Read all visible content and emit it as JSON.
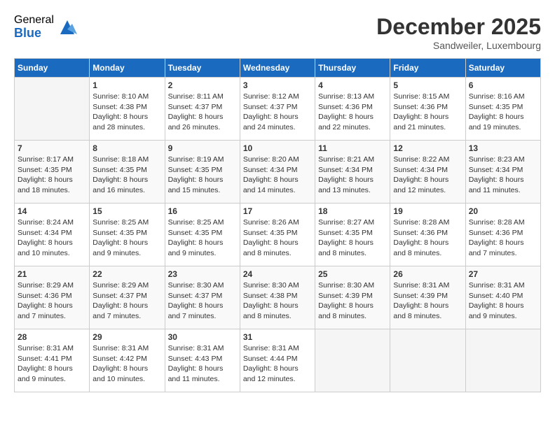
{
  "logo": {
    "general": "General",
    "blue": "Blue"
  },
  "title": "December 2025",
  "location": "Sandweiler, Luxembourg",
  "days_of_week": [
    "Sunday",
    "Monday",
    "Tuesday",
    "Wednesday",
    "Thursday",
    "Friday",
    "Saturday"
  ],
  "weeks": [
    [
      {
        "day": "",
        "sunrise": "",
        "sunset": "",
        "daylight": ""
      },
      {
        "day": "1",
        "sunrise": "Sunrise: 8:10 AM",
        "sunset": "Sunset: 4:38 PM",
        "daylight": "Daylight: 8 hours and 28 minutes."
      },
      {
        "day": "2",
        "sunrise": "Sunrise: 8:11 AM",
        "sunset": "Sunset: 4:37 PM",
        "daylight": "Daylight: 8 hours and 26 minutes."
      },
      {
        "day": "3",
        "sunrise": "Sunrise: 8:12 AM",
        "sunset": "Sunset: 4:37 PM",
        "daylight": "Daylight: 8 hours and 24 minutes."
      },
      {
        "day": "4",
        "sunrise": "Sunrise: 8:13 AM",
        "sunset": "Sunset: 4:36 PM",
        "daylight": "Daylight: 8 hours and 22 minutes."
      },
      {
        "day": "5",
        "sunrise": "Sunrise: 8:15 AM",
        "sunset": "Sunset: 4:36 PM",
        "daylight": "Daylight: 8 hours and 21 minutes."
      },
      {
        "day": "6",
        "sunrise": "Sunrise: 8:16 AM",
        "sunset": "Sunset: 4:35 PM",
        "daylight": "Daylight: 8 hours and 19 minutes."
      }
    ],
    [
      {
        "day": "7",
        "sunrise": "Sunrise: 8:17 AM",
        "sunset": "Sunset: 4:35 PM",
        "daylight": "Daylight: 8 hours and 18 minutes."
      },
      {
        "day": "8",
        "sunrise": "Sunrise: 8:18 AM",
        "sunset": "Sunset: 4:35 PM",
        "daylight": "Daylight: 8 hours and 16 minutes."
      },
      {
        "day": "9",
        "sunrise": "Sunrise: 8:19 AM",
        "sunset": "Sunset: 4:35 PM",
        "daylight": "Daylight: 8 hours and 15 minutes."
      },
      {
        "day": "10",
        "sunrise": "Sunrise: 8:20 AM",
        "sunset": "Sunset: 4:34 PM",
        "daylight": "Daylight: 8 hours and 14 minutes."
      },
      {
        "day": "11",
        "sunrise": "Sunrise: 8:21 AM",
        "sunset": "Sunset: 4:34 PM",
        "daylight": "Daylight: 8 hours and 13 minutes."
      },
      {
        "day": "12",
        "sunrise": "Sunrise: 8:22 AM",
        "sunset": "Sunset: 4:34 PM",
        "daylight": "Daylight: 8 hours and 12 minutes."
      },
      {
        "day": "13",
        "sunrise": "Sunrise: 8:23 AM",
        "sunset": "Sunset: 4:34 PM",
        "daylight": "Daylight: 8 hours and 11 minutes."
      }
    ],
    [
      {
        "day": "14",
        "sunrise": "Sunrise: 8:24 AM",
        "sunset": "Sunset: 4:34 PM",
        "daylight": "Daylight: 8 hours and 10 minutes."
      },
      {
        "day": "15",
        "sunrise": "Sunrise: 8:25 AM",
        "sunset": "Sunset: 4:35 PM",
        "daylight": "Daylight: 8 hours and 9 minutes."
      },
      {
        "day": "16",
        "sunrise": "Sunrise: 8:25 AM",
        "sunset": "Sunset: 4:35 PM",
        "daylight": "Daylight: 8 hours and 9 minutes."
      },
      {
        "day": "17",
        "sunrise": "Sunrise: 8:26 AM",
        "sunset": "Sunset: 4:35 PM",
        "daylight": "Daylight: 8 hours and 8 minutes."
      },
      {
        "day": "18",
        "sunrise": "Sunrise: 8:27 AM",
        "sunset": "Sunset: 4:35 PM",
        "daylight": "Daylight: 8 hours and 8 minutes."
      },
      {
        "day": "19",
        "sunrise": "Sunrise: 8:28 AM",
        "sunset": "Sunset: 4:36 PM",
        "daylight": "Daylight: 8 hours and 8 minutes."
      },
      {
        "day": "20",
        "sunrise": "Sunrise: 8:28 AM",
        "sunset": "Sunset: 4:36 PM",
        "daylight": "Daylight: 8 hours and 7 minutes."
      }
    ],
    [
      {
        "day": "21",
        "sunrise": "Sunrise: 8:29 AM",
        "sunset": "Sunset: 4:36 PM",
        "daylight": "Daylight: 8 hours and 7 minutes."
      },
      {
        "day": "22",
        "sunrise": "Sunrise: 8:29 AM",
        "sunset": "Sunset: 4:37 PM",
        "daylight": "Daylight: 8 hours and 7 minutes."
      },
      {
        "day": "23",
        "sunrise": "Sunrise: 8:30 AM",
        "sunset": "Sunset: 4:37 PM",
        "daylight": "Daylight: 8 hours and 7 minutes."
      },
      {
        "day": "24",
        "sunrise": "Sunrise: 8:30 AM",
        "sunset": "Sunset: 4:38 PM",
        "daylight": "Daylight: 8 hours and 8 minutes."
      },
      {
        "day": "25",
        "sunrise": "Sunrise: 8:30 AM",
        "sunset": "Sunset: 4:39 PM",
        "daylight": "Daylight: 8 hours and 8 minutes."
      },
      {
        "day": "26",
        "sunrise": "Sunrise: 8:31 AM",
        "sunset": "Sunset: 4:39 PM",
        "daylight": "Daylight: 8 hours and 8 minutes."
      },
      {
        "day": "27",
        "sunrise": "Sunrise: 8:31 AM",
        "sunset": "Sunset: 4:40 PM",
        "daylight": "Daylight: 8 hours and 9 minutes."
      }
    ],
    [
      {
        "day": "28",
        "sunrise": "Sunrise: 8:31 AM",
        "sunset": "Sunset: 4:41 PM",
        "daylight": "Daylight: 8 hours and 9 minutes."
      },
      {
        "day": "29",
        "sunrise": "Sunrise: 8:31 AM",
        "sunset": "Sunset: 4:42 PM",
        "daylight": "Daylight: 8 hours and 10 minutes."
      },
      {
        "day": "30",
        "sunrise": "Sunrise: 8:31 AM",
        "sunset": "Sunset: 4:43 PM",
        "daylight": "Daylight: 8 hours and 11 minutes."
      },
      {
        "day": "31",
        "sunrise": "Sunrise: 8:31 AM",
        "sunset": "Sunset: 4:44 PM",
        "daylight": "Daylight: 8 hours and 12 minutes."
      },
      {
        "day": "",
        "sunrise": "",
        "sunset": "",
        "daylight": ""
      },
      {
        "day": "",
        "sunrise": "",
        "sunset": "",
        "daylight": ""
      },
      {
        "day": "",
        "sunrise": "",
        "sunset": "",
        "daylight": ""
      }
    ]
  ]
}
